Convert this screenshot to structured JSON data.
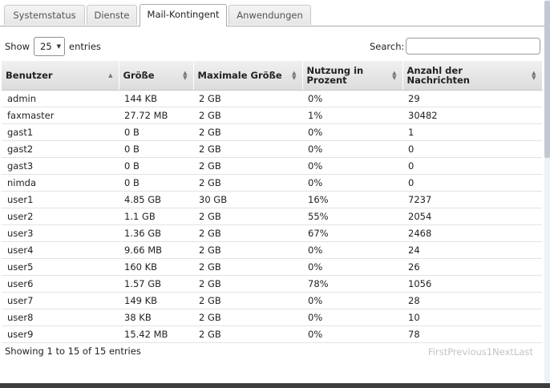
{
  "tabs": [
    "Systemstatus",
    "Dienste",
    "Mail-Kontingent",
    "Anwendungen"
  ],
  "active_tab": "Mail-Kontingent",
  "length": {
    "prefix": "Show",
    "value": "25",
    "suffix": "entries"
  },
  "search": {
    "label": "Search:",
    "value": ""
  },
  "table": {
    "columns": [
      "Benutzer",
      "Größe",
      "Maximale Größe",
      "Nutzung in Prozent",
      "Anzahl der Nachrichten"
    ],
    "sorted_column": "Benutzer",
    "rows": [
      [
        "admin",
        "144 KB",
        "2 GB",
        "0%",
        "29"
      ],
      [
        "faxmaster",
        "27.72 MB",
        "2 GB",
        "1%",
        "30482"
      ],
      [
        "gast1",
        "0 B",
        "2 GB",
        "0%",
        "1"
      ],
      [
        "gast2",
        "0 B",
        "2 GB",
        "0%",
        "0"
      ],
      [
        "gast3",
        "0 B",
        "2 GB",
        "0%",
        "0"
      ],
      [
        "nimda",
        "0 B",
        "2 GB",
        "0%",
        "0"
      ],
      [
        "user1",
        "4.85 GB",
        "30 GB",
        "16%",
        "7237"
      ],
      [
        "user2",
        "1.1 GB",
        "2 GB",
        "55%",
        "2054"
      ],
      [
        "user3",
        "1.36 GB",
        "2 GB",
        "67%",
        "2468"
      ],
      [
        "user4",
        "9.66 MB",
        "2 GB",
        "0%",
        "24"
      ],
      [
        "user5",
        "160 KB",
        "2 GB",
        "0%",
        "26"
      ],
      [
        "user6",
        "1.57 GB",
        "2 GB",
        "78%",
        "1056"
      ],
      [
        "user7",
        "149 KB",
        "2 GB",
        "0%",
        "28"
      ],
      [
        "user8",
        "38 KB",
        "2 GB",
        "0%",
        "10"
      ],
      [
        "user9",
        "15.42 MB",
        "2 GB",
        "0%",
        "78"
      ]
    ]
  },
  "footer": {
    "info": "Showing 1 to 15 of 15 entries",
    "pager": [
      "First",
      "Previous",
      "1",
      "Next",
      "Last"
    ]
  },
  "colors": {
    "header_bg": "#dcdcdc",
    "pager_disabled": "#c3c3c3",
    "tab_border": "#aaaaaa"
  },
  "icons": {
    "sort_asc": "sort-asc-icon",
    "sort_both": "sort-both-icon",
    "select_arrow": "chevron-down-icon"
  }
}
